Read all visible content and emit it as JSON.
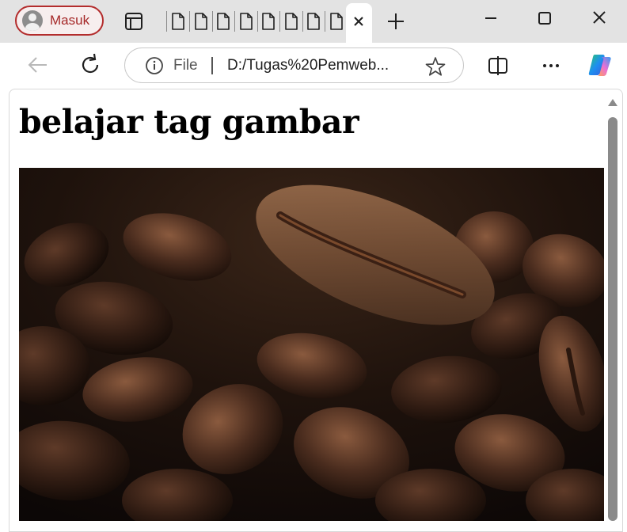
{
  "titlebar": {
    "profile_label": "Masuk",
    "tab_count_visible": 8,
    "close_tab_icon": "close-icon",
    "new_tab_icon": "plus-icon"
  },
  "window_controls": [
    "minimize-icon",
    "maximize-icon",
    "close-icon"
  ],
  "toolbar": {
    "back_icon": "arrow-left-icon",
    "refresh_icon": "refresh-icon",
    "split_icon": "split-screen-icon",
    "more_icon": "more-icon",
    "copilot_icon": "copilot-icon"
  },
  "address": {
    "scheme_label": "File",
    "url": "D:/Tugas%20Pemweb..."
  },
  "page": {
    "heading": "belajar tag gambar",
    "image_description_icon": "coffee-beans-photo"
  },
  "colors": {
    "titlebar_bg": "#e3e3e3",
    "profile_accent": "#a52828",
    "copilot_blue": "#1d8ff0",
    "copilot_green": "#2dc76d"
  }
}
